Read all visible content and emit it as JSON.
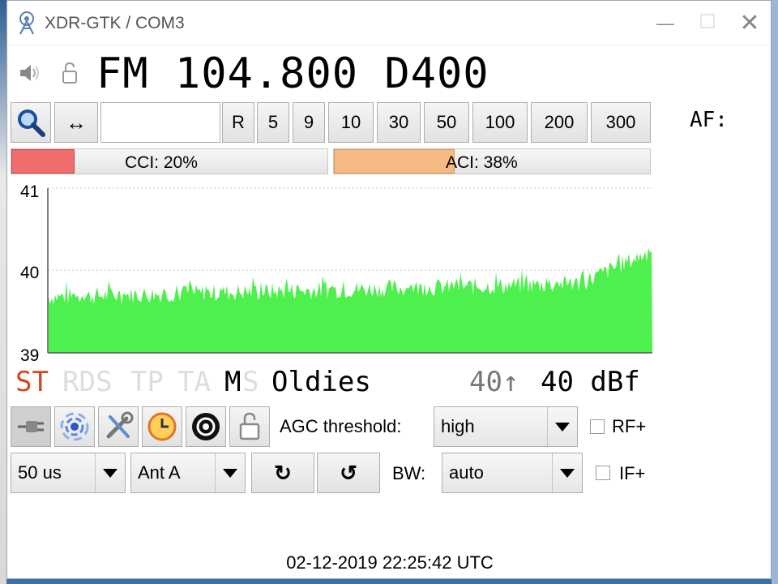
{
  "window": {
    "title": "XDR-GTK / COM3",
    "minimize_glyph": "—",
    "close_glyph": "✕"
  },
  "tuner": {
    "frequency_display": "FM 104.800 D400",
    "frequency_input": "",
    "af_label": "AF:"
  },
  "step_buttons": [
    "R",
    "5",
    "9",
    "10",
    "30",
    "50",
    "100",
    "200",
    "300"
  ],
  "arrow_button_label": "↔",
  "meters": {
    "cci": {
      "label": "CCI: 20%",
      "value": 20
    },
    "aci": {
      "label": "ACI: 38%",
      "value": 38
    }
  },
  "graph": {
    "y_max": "41",
    "y_mid": "40",
    "y_min": "39",
    "ylim": [
      39,
      41
    ],
    "fill_color": "#4df04d"
  },
  "status": {
    "st": "ST",
    "rds": "RDS",
    "tp": "TP",
    "ta": "TA",
    "m": "M",
    "s": "S",
    "ps_name": "Oldies",
    "max_level": "40↑",
    "signal_level": "40 dBf"
  },
  "controls": {
    "agc_label": "AGC threshold:",
    "agc_value": "high",
    "rf_plus_label": "RF+",
    "deemphasis_value": "50 us",
    "antenna_value": "Ant A",
    "rotate_ccw_glyph": "↻",
    "rotate_cw_glyph": "↺",
    "bw_label": "BW:",
    "bw_value": "auto",
    "if_plus_label": "IF+"
  },
  "footer": {
    "datetime": "02-12-2019 22:25:42 UTC"
  },
  "colors": {
    "st_active": "#d7471c",
    "inactive_flag": "#dddddd",
    "cci_fill": "#f06d6d",
    "aci_fill": "#f6bb82"
  },
  "icons": [
    "app-icon",
    "speaker-icon",
    "lock-icon",
    "search-icon",
    "plug-icon",
    "rds-icon",
    "tools-icon",
    "clock-icon",
    "pattern-icon",
    "unlock-icon"
  ]
}
